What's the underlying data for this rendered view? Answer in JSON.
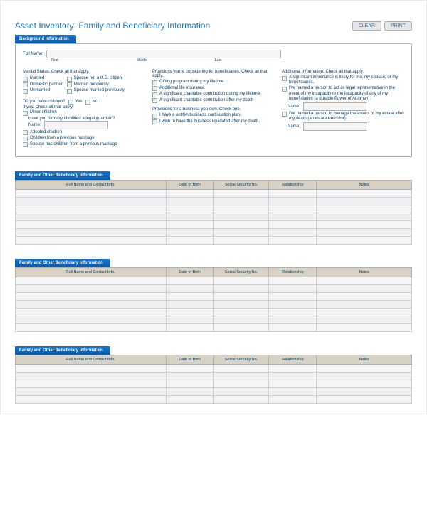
{
  "title": "Asset Inventory: Family and Beneficiary Information",
  "buttons": {
    "clear": "CLEAR",
    "print": "PRINT"
  },
  "section_bg": "Background Information",
  "fullName": {
    "label": "Full Name:",
    "first": "First",
    "middle": "Middle",
    "last": "Last"
  },
  "marital": {
    "heading": "Marital Status: Check all that apply.",
    "opts1": [
      "Married",
      "Domestic partner",
      "Unmarried"
    ],
    "opts2": [
      "Spouse not a U.S. citizen",
      "Married previously",
      "Spouse married previously"
    ]
  },
  "children": {
    "q": "Do you have children?",
    "yes": "Yes",
    "no": "No",
    "ifyes": "If yes: Check all that apply.",
    "minor": "Minor children",
    "guardianQ": "Have you formally identified a legal guardian?",
    "nameLabel": "Name:",
    "extra": [
      "Adopted children",
      "Children from a previous marriage",
      "Spouse has children from a previous marriage"
    ]
  },
  "provisions": {
    "heading": "Provisions you're considering for beneficiaries: Check all that apply.",
    "items": [
      "Gifting program during my lifetime",
      "Additional life insurance",
      "A significant charitable contribution during my lifetime",
      "A significant charitable contribution after my death"
    ]
  },
  "business": {
    "heading": "Provisions for a business you own: Check one.",
    "items": [
      "I have a written business continuation plan.",
      "I wish to have the business liquidated after my death."
    ]
  },
  "additional": {
    "heading": "Additional Information: Check all that apply.",
    "inherit": "A significant inheritance is likely for me, my spouse, or my beneficiaries.",
    "poa": "I've named a person to act as legal representative in the event of my incapacity or the incapacity of any of my beneficiaries (a durable Power of Attorney).",
    "nameLabel1": "Name:",
    "executor": "I've named a person to manage the assets of my estate after my death (an estate executor).",
    "nameLabel2": "Name:"
  },
  "benef_tab": "Family and Other Beneficiary Information",
  "columns": {
    "contact": "Full Name and Contact Info.",
    "dob": "Date of Birth",
    "ssn": "Social Security No.",
    "rel": "Relationship",
    "notes": "Notes"
  }
}
